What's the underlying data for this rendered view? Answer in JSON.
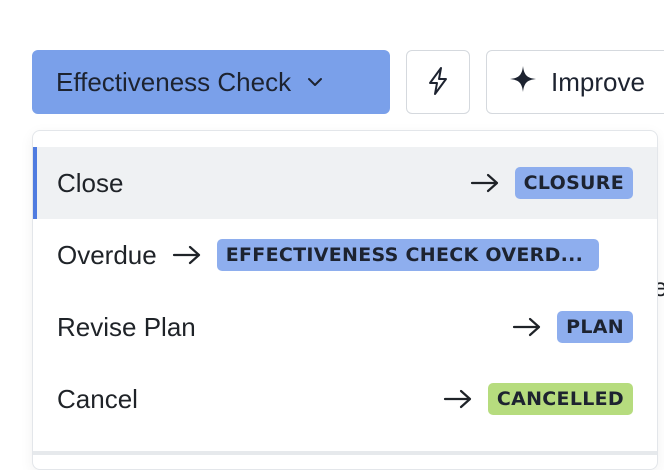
{
  "toolbar": {
    "status_label": "Effectiveness Check",
    "improve_label": "Improve"
  },
  "background": {
    "peek_text": "e"
  },
  "menu": {
    "items": [
      {
        "label": "Close",
        "target": "CLOSURE",
        "badge_color": "#8eaeee",
        "active": true
      },
      {
        "label": "Overdue",
        "target": "EFFECTIVENESS CHECK OVERD...",
        "badge_color": "#8eaeee",
        "active": false
      },
      {
        "label": "Revise Plan",
        "target": "PLAN",
        "badge_color": "#8eaeee",
        "active": false
      },
      {
        "label": "Cancel",
        "target": "CANCELLED",
        "badge_color": "#b6dc7e",
        "active": false
      }
    ]
  },
  "icons": {
    "status_chevron": "chevron-down-icon",
    "action_icon": "lightning-icon",
    "improve_icon": "sparkle-icon",
    "transition_arrow": "arrow-right-icon"
  },
  "colors": {
    "primary": "#7aa0ea",
    "active_accent": "#4f7be0",
    "badge_blue": "#8eaeee",
    "badge_green": "#b6dc7e"
  }
}
